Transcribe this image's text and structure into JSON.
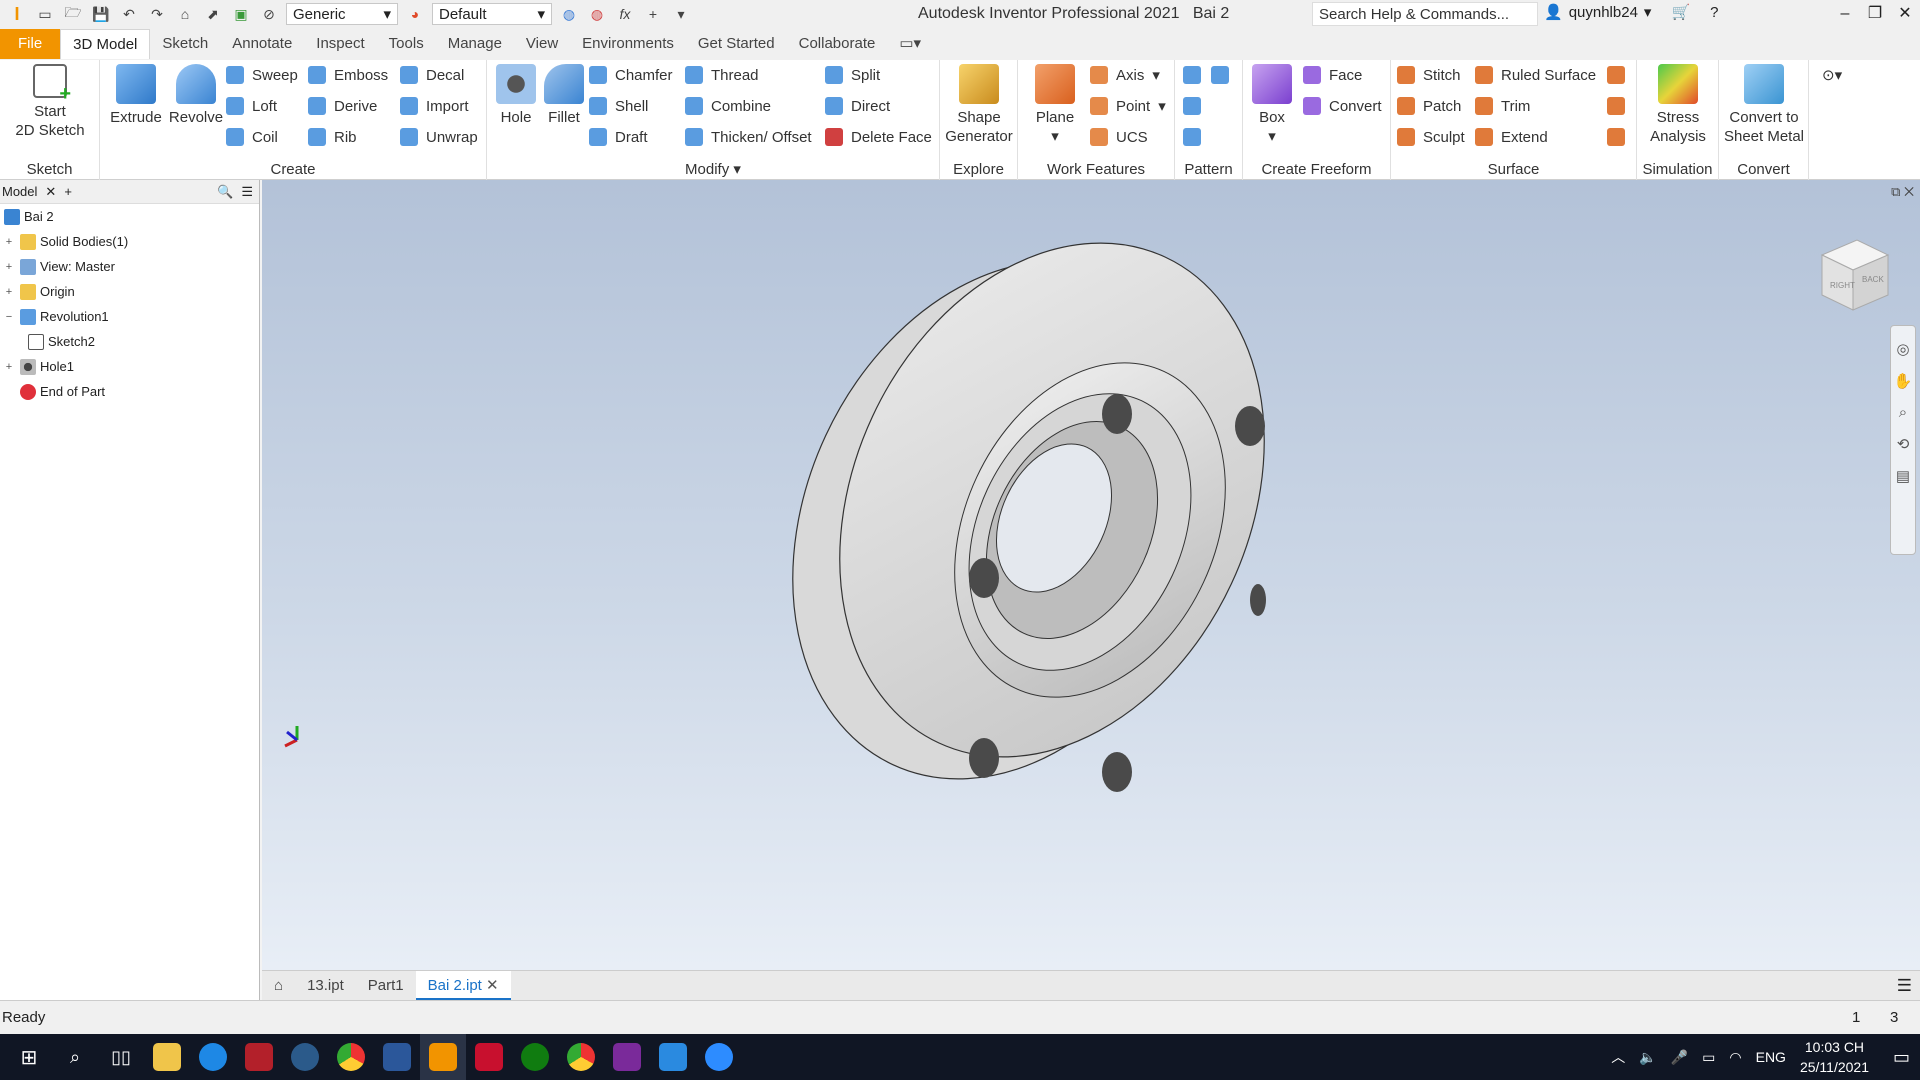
{
  "titlebar": {
    "style_select": "Generic",
    "appearance_select": "Default",
    "app_title": "Autodesk Inventor Professional 2021",
    "doc_title": "Bai 2",
    "search_placeholder": "Search Help & Commands...",
    "username": "quynhlb24"
  },
  "tabs": [
    "File",
    "3D Model",
    "Sketch",
    "Annotate",
    "Inspect",
    "Tools",
    "Manage",
    "View",
    "Environments",
    "Get Started",
    "Collaborate"
  ],
  "ribbon": {
    "sketch": {
      "start": "Start",
      "start2": "2D Sketch",
      "title": "Sketch"
    },
    "create": {
      "extrude": "Extrude",
      "revolve": "Revolve",
      "sweep": "Sweep",
      "loft": "Loft",
      "coil": "Coil",
      "emboss": "Emboss",
      "derive": "Derive",
      "rib": "Rib",
      "decal": "Decal",
      "import": "Import",
      "unwrap": "Unwrap",
      "title": "Create"
    },
    "modify": {
      "hole": "Hole",
      "fillet": "Fillet",
      "chamfer": "Chamfer",
      "shell": "Shell",
      "draft": "Draft",
      "thread": "Thread",
      "combine": "Combine",
      "thicken": "Thicken/ Offset",
      "split": "Split",
      "direct": "Direct",
      "delete_face": "Delete Face",
      "title": "Modify"
    },
    "explore": {
      "shape": "Shape",
      "generator": "Generator",
      "title": "Explore"
    },
    "work": {
      "plane": "Plane",
      "axis": "Axis",
      "point": "Point",
      "ucs": "UCS",
      "title": "Work Features"
    },
    "pattern": {
      "title": "Pattern"
    },
    "freeform": {
      "box": "Box",
      "face": "Face",
      "convert": "Convert",
      "title": "Create Freeform"
    },
    "surface": {
      "stitch": "Stitch",
      "patch": "Patch",
      "sculpt": "Sculpt",
      "ruled": "Ruled Surface",
      "trim": "Trim",
      "extend": "Extend",
      "title": "Surface"
    },
    "simulation": {
      "stress": "Stress",
      "analysis": "Analysis",
      "title": "Simulation"
    },
    "convert": {
      "c1": "Convert to",
      "c2": "Sheet Metal",
      "title": "Convert"
    }
  },
  "browser": {
    "tab": "Model",
    "items": [
      {
        "label": "Bai 2",
        "level": 0,
        "toggle": ""
      },
      {
        "label": "Solid Bodies(1)",
        "level": 1,
        "toggle": "+"
      },
      {
        "label": "View: Master",
        "level": 1,
        "toggle": "+"
      },
      {
        "label": "Origin",
        "level": 1,
        "toggle": "+"
      },
      {
        "label": "Revolution1",
        "level": 1,
        "toggle": "−"
      },
      {
        "label": "Sketch2",
        "level": 2,
        "toggle": ""
      },
      {
        "label": "Hole1",
        "level": 1,
        "toggle": "+"
      },
      {
        "label": "End of Part",
        "level": 1,
        "toggle": ""
      }
    ]
  },
  "viewcube": {
    "right": "RIGHT",
    "back": "BACK"
  },
  "doc_tabs": [
    "13.ipt",
    "Part1",
    "Bai 2.ipt"
  ],
  "status": {
    "text": "Ready",
    "n1": "1",
    "n2": "3"
  },
  "taskbar": {
    "lang": "ENG",
    "time": "10:03 CH",
    "date": "25/11/2021"
  }
}
